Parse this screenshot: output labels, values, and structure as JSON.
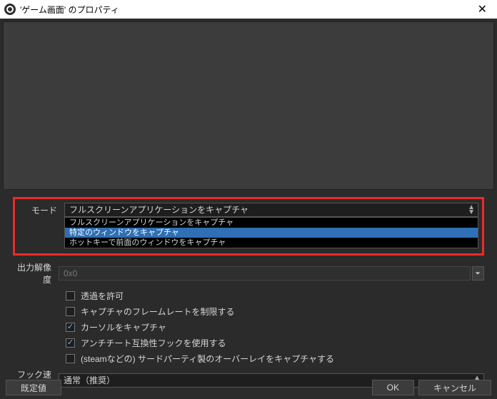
{
  "window": {
    "title": "'ゲーム画面' のプロパティ"
  },
  "mode": {
    "label": "モード",
    "selected": "フルスクリーンアプリケーションをキャプチャ",
    "options": [
      "フルスクリーンアプリケーションをキャプチャ",
      "特定のウィンドウをキャプチャ",
      "ホットキーで前面のウィンドウをキャプチャ"
    ],
    "selected_index": 1
  },
  "resolution": {
    "label": "出力解像度",
    "value": "0x0"
  },
  "checks": {
    "transparency": {
      "label": "透過を許可",
      "checked": false
    },
    "limit_fps": {
      "label": "キャプチャのフレームレートを制限する",
      "checked": false
    },
    "cursor": {
      "label": "カーソルをキャプチャ",
      "checked": true
    },
    "anticheat": {
      "label": "アンチチート互換性フックを使用する",
      "checked": true
    },
    "overlay": {
      "label": "(steamなどの) サードパーティ製のオーバーレイをキャプチャする",
      "checked": false
    }
  },
  "hook": {
    "label": "フック速度",
    "value": "通常（推奨）"
  },
  "buttons": {
    "defaults": "既定値",
    "ok": "OK",
    "cancel": "キャンセル"
  }
}
